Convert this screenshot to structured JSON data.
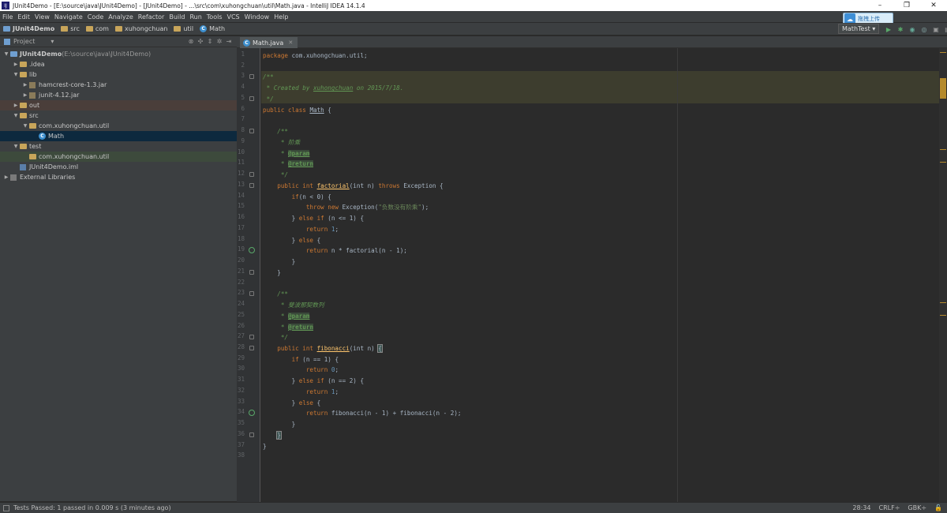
{
  "window": {
    "title": "JUnit4Demo - [E:\\source\\java\\JUnit4Demo] - [JUnit4Demo] - ...\\src\\com\\xuhongchuan\\util\\Math.java - IntelliJ IDEA 14.1.4",
    "cloud_badge": "拖拽上传"
  },
  "menu": [
    "File",
    "Edit",
    "View",
    "Navigate",
    "Code",
    "Analyze",
    "Refactor",
    "Build",
    "Run",
    "Tools",
    "VCS",
    "Window",
    "Help"
  ],
  "breadcrumbs": [
    "JUnit4Demo",
    "src",
    "com",
    "xuhongchuan",
    "util",
    "Math"
  ],
  "run_config": "MathTest",
  "project_panel": {
    "title": "Project",
    "tree": [
      {
        "label": "JUnit4Demo",
        "extra": " (E:\\source\\java\\JUnit4Demo)",
        "depth": 0,
        "open": true,
        "icon": "project-icon"
      },
      {
        "label": ".idea",
        "depth": 1,
        "open": false,
        "icon": "folder-icon"
      },
      {
        "label": "lib",
        "depth": 1,
        "open": true,
        "icon": "folder-icon"
      },
      {
        "label": "hamcrest-core-1.3.jar",
        "depth": 2,
        "open": false,
        "icon": "jar-icon"
      },
      {
        "label": "junit-4.12.jar",
        "depth": 2,
        "open": false,
        "icon": "jar-icon"
      },
      {
        "label": "out",
        "depth": 1,
        "open": false,
        "icon": "folder-icon"
      },
      {
        "label": "src",
        "depth": 1,
        "open": true,
        "icon": "folder-icon"
      },
      {
        "label": "com.xuhongchuan.util",
        "depth": 2,
        "open": true,
        "icon": "package-icon"
      },
      {
        "label": "Math",
        "depth": 3,
        "open": null,
        "icon": "class-icon"
      },
      {
        "label": "test",
        "depth": 1,
        "open": true,
        "icon": "folder-icon"
      },
      {
        "label": "com.xuhongchuan.util",
        "depth": 2,
        "open": null,
        "icon": "package-icon"
      },
      {
        "label": "JUnit4Demo.iml",
        "depth": 1,
        "open": null,
        "icon": "iml-icon"
      },
      {
        "label": "External Libraries",
        "depth": 0,
        "open": false,
        "icon": "libraries-icon"
      }
    ]
  },
  "editor": {
    "tab": "Math.java",
    "lines": [
      [
        [
          "kw",
          "package "
        ],
        [
          "",
          "com.xuhongchuan.util;"
        ]
      ],
      [],
      [
        [
          "cm",
          "/**"
        ]
      ],
      [
        [
          "cm",
          " * Created by "
        ],
        [
          "cmu",
          "xuhongchuan"
        ],
        [
          "cm",
          " on 2015/7/18."
        ]
      ],
      [
        [
          "cm",
          " */"
        ]
      ],
      [
        [
          "kw",
          "public class "
        ],
        [
          "ul",
          "Math"
        ],
        [
          "",
          " {"
        ]
      ],
      [],
      [
        [
          "cm",
          "    /**"
        ]
      ],
      [
        [
          "cm",
          "     * 阶乘"
        ]
      ],
      [
        [
          "cm",
          "     * "
        ],
        [
          "tg",
          "@param"
        ]
      ],
      [
        [
          "cm",
          "     * "
        ],
        [
          "tg",
          "@return"
        ]
      ],
      [
        [
          "cm",
          "     */"
        ]
      ],
      [
        [
          "kw",
          "    public int "
        ],
        [
          "fnu",
          "factorial"
        ],
        [
          "",
          "(int n) "
        ],
        [
          "kw",
          "throws "
        ],
        [
          "",
          "Exception {"
        ]
      ],
      [
        [
          "kw",
          "        if"
        ],
        [
          "",
          "(n < 0) {"
        ]
      ],
      [
        [
          "kw",
          "            throw new "
        ],
        [
          "",
          "Exception("
        ],
        [
          "st",
          "\"负数没有阶乘\""
        ],
        [
          "",
          ");"
        ]
      ],
      [
        [
          "",
          "        } "
        ],
        [
          "kw",
          "else if "
        ],
        [
          "",
          "(n <= 1) {"
        ]
      ],
      [
        [
          "kw",
          "            return "
        ],
        [
          "nm",
          "1"
        ],
        [
          "",
          ";"
        ]
      ],
      [
        [
          "",
          "        } "
        ],
        [
          "kw",
          "else "
        ],
        [
          "",
          "{"
        ]
      ],
      [
        [
          "kw",
          "            return "
        ],
        [
          "",
          "n * factorial(n - 1);"
        ]
      ],
      [
        [
          "",
          "        }"
        ]
      ],
      [
        [
          "",
          "    }"
        ]
      ],
      [],
      [
        [
          "cm",
          "    /**"
        ]
      ],
      [
        [
          "cm",
          "     * 斐波那契数列"
        ]
      ],
      [
        [
          "cm",
          "     * "
        ],
        [
          "tg",
          "@param"
        ]
      ],
      [
        [
          "cm",
          "     * "
        ],
        [
          "tg",
          "@return"
        ]
      ],
      [
        [
          "cm",
          "     */"
        ]
      ],
      [
        [
          "kw",
          "    public int "
        ],
        [
          "fnu",
          "fibonacci"
        ],
        [
          "",
          "(int n) "
        ],
        [
          "caret",
          "{"
        ]
      ],
      [
        [
          "kw",
          "        if "
        ],
        [
          "",
          "(n == 1) {"
        ]
      ],
      [
        [
          "kw",
          "            return "
        ],
        [
          "nm",
          "0"
        ],
        [
          "",
          ";"
        ]
      ],
      [
        [
          "",
          "        } "
        ],
        [
          "kw",
          "else if "
        ],
        [
          "",
          "(n == 2) {"
        ]
      ],
      [
        [
          "kw",
          "            return "
        ],
        [
          "nm",
          "1"
        ],
        [
          "",
          ";"
        ]
      ],
      [
        [
          "",
          "        } "
        ],
        [
          "kw",
          "else "
        ],
        [
          "",
          "{"
        ]
      ],
      [
        [
          "kw",
          "            return "
        ],
        [
          "",
          "fibonacci(n - 1) + fibonacci(n - 2);"
        ]
      ],
      [
        [
          "",
          "        }"
        ]
      ],
      [
        [
          "",
          "    "
        ],
        [
          "caret",
          "}"
        ]
      ],
      [
        [
          "",
          "}"
        ]
      ],
      []
    ]
  },
  "status": {
    "message": "Tests Passed: 1 passed in 0.009 s (3 minutes ago)",
    "position": "28:34",
    "line_sep": "CRLF÷",
    "encoding": "GBK÷"
  },
  "colors": {
    "keyword": "#cc7832",
    "comment": "#629755",
    "string": "#6a8759",
    "number": "#6897bb",
    "function": "#ffc66d"
  }
}
